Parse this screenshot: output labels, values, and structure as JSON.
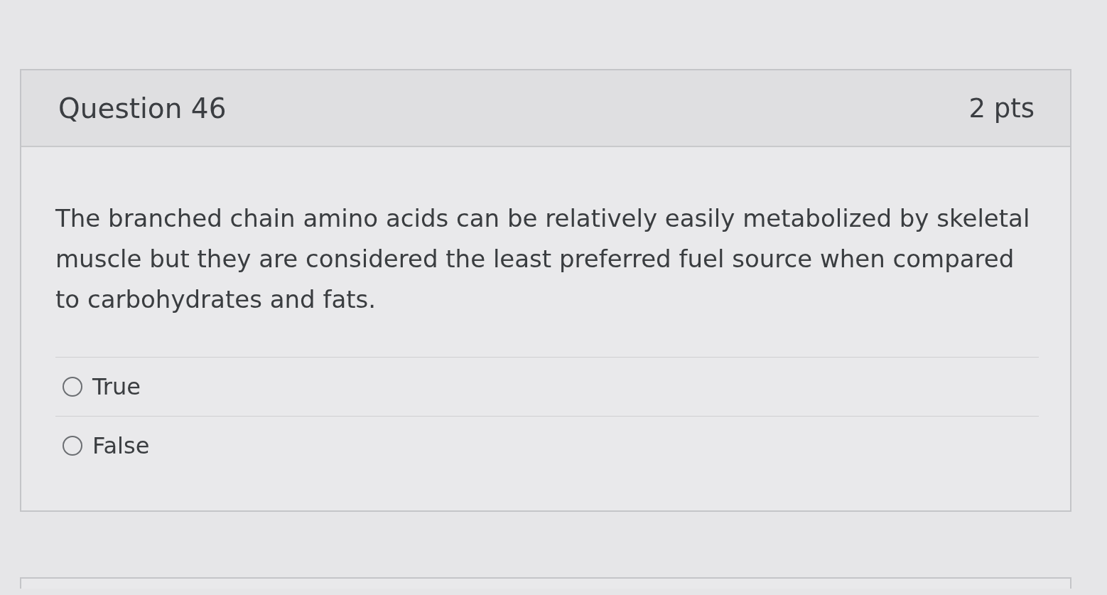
{
  "question": {
    "title": "Question 46",
    "points": "2 pts",
    "text": "The branched chain amino acids can be relatively easily metabolized by skeletal muscle but they are considered the least preferred fuel source when compared to carbohydrates and fats.",
    "answers": [
      {
        "label": "True",
        "selected": false
      },
      {
        "label": "False",
        "selected": false
      }
    ]
  }
}
